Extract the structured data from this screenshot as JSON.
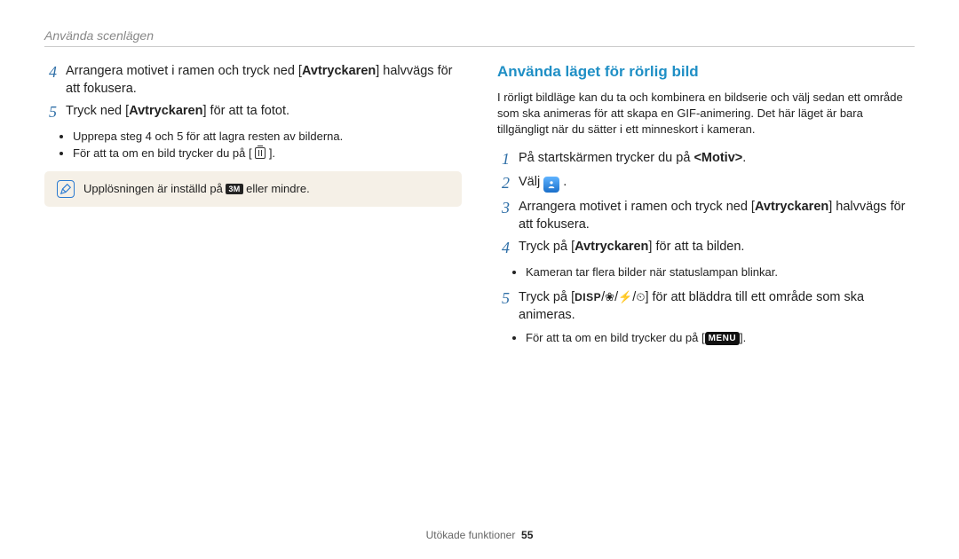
{
  "header": "Använda scenlägen",
  "left": {
    "step4": {
      "num": "4",
      "text_a": "Arrangera motivet i ramen och tryck ned [",
      "b": "Avtryckaren",
      "text_b": "] halvvägs för att fokusera."
    },
    "step5": {
      "num": "5",
      "text_a": "Tryck ned [",
      "b": "Avtryckaren",
      "text_b": "] för att ta fotot."
    },
    "bullets": [
      "Upprepa steg 4 och 5 för att lagra resten av bilderna.",
      "För att ta om en bild trycker du på [ "
    ],
    "bullet2_tail": " ].",
    "note_a": "Upplösningen är inställd på ",
    "note_res": "3M",
    "note_b": " eller mindre."
  },
  "right": {
    "title": "Använda läget för rörlig bild",
    "intro": "I rörligt bildläge kan du ta och kombinera en bildserie och välj sedan ett område som ska animeras för att skapa en GIF-animering. Det här läget är bara tillgängligt när du sätter i ett minneskort i kameran.",
    "step1": {
      "num": "1",
      "text_a": "På startskärmen trycker du på ",
      "b": "<Motiv>",
      "text_b": "."
    },
    "step2": {
      "num": "2",
      "text": "Välj ",
      "tail": "."
    },
    "step3": {
      "num": "3",
      "text_a": "Arrangera motivet i ramen och tryck ned [",
      "b": "Avtryckaren",
      "text_b": "] halvvägs för att fokusera."
    },
    "step4": {
      "num": "4",
      "text_a": "Tryck på [",
      "b": "Avtryckaren",
      "text_b": "] för att ta bilden."
    },
    "r_bullets": [
      "Kameran tar flera bilder när statuslampan blinkar."
    ],
    "step5": {
      "num": "5",
      "text_a": "Tryck på [",
      "disp": "DISP",
      "sep": "/",
      "text_b": "] för att bläddra till ett område som ska animeras."
    },
    "r_bullets2_a": "För att ta om en bild trycker du på [",
    "menu": "MENU",
    "r_bullets2_b": "]."
  },
  "footer": {
    "label": "Utökade funktioner",
    "page": "55"
  }
}
